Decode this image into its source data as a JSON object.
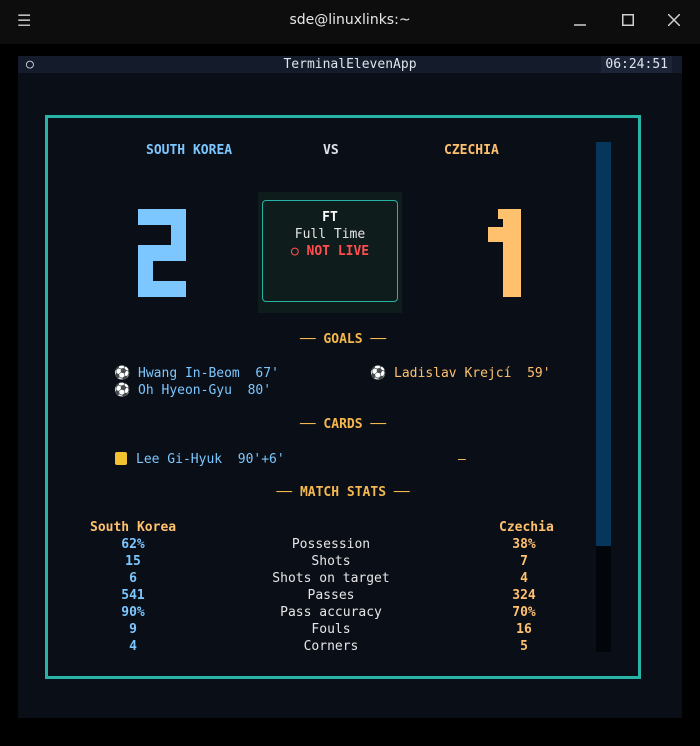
{
  "window": {
    "title": "sde@linuxlinks:~"
  },
  "app": {
    "title": "TerminalElevenApp",
    "clock": "06:24:51",
    "indicator": "○"
  },
  "match": {
    "home_team": "SOUTH KOREA",
    "away_team": "CZECHIA",
    "vs": "VS",
    "home_score": 2,
    "away_score": 1,
    "status_short": "FT",
    "status_long": "Full Time",
    "live_status": "○ NOT LIVE"
  },
  "sections": {
    "goals": "── GOALS ──",
    "cards": "── CARDS ──",
    "stats": "── MATCH STATS ──"
  },
  "goals": {
    "home": [
      {
        "player": "Hwang In-Beom",
        "minute": "67'"
      },
      {
        "player": "Oh Hyeon-Gyu",
        "minute": "80'"
      }
    ],
    "away": [
      {
        "player": "Ladislav Krejcí",
        "minute": "59'"
      }
    ]
  },
  "cards": {
    "home": [
      {
        "player": "Lee Gi-Hyuk",
        "minute": "90'+6'"
      }
    ],
    "away_placeholder": "–"
  },
  "stats": {
    "home_label": "South Korea",
    "away_label": "Czechia",
    "rows": [
      {
        "label": "Possession",
        "home": "62%",
        "away": "38%"
      },
      {
        "label": "Shots",
        "home": "15",
        "away": "7"
      },
      {
        "label": "Shots on target",
        "home": "6",
        "away": "4"
      },
      {
        "label": "Passes",
        "home": "541",
        "away": "324"
      },
      {
        "label": "Pass accuracy",
        "home": "90%",
        "away": "70%"
      },
      {
        "label": "Fouls",
        "home": "9",
        "away": "16"
      },
      {
        "label": "Corners",
        "home": "4",
        "away": "5"
      }
    ]
  },
  "colors": {
    "home": "#7cc7ff",
    "away": "#ffc16e",
    "accent": "#27b3a6",
    "section": "#f5b84f",
    "live_off": "#ff4d4d"
  },
  "icons": {
    "goal": "soccer-ball-icon",
    "card": "yellow-card-icon",
    "menu": "hamburger-icon"
  }
}
